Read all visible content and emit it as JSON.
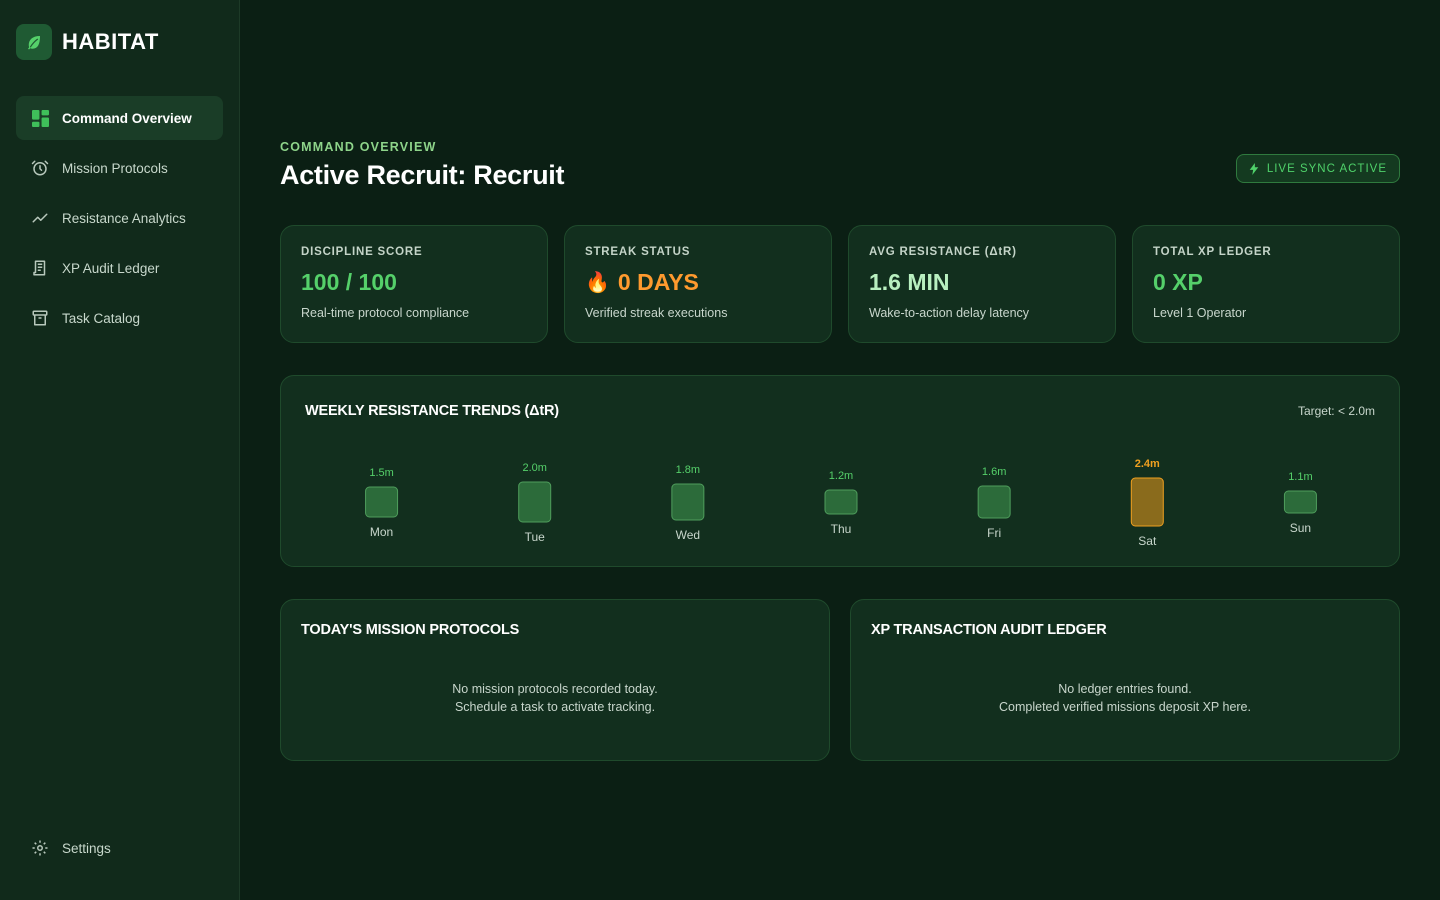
{
  "brand": {
    "name": "HABITAT"
  },
  "sidebar": {
    "items": [
      {
        "label": "Command Overview",
        "icon": "dashboard-icon",
        "active": true
      },
      {
        "label": "Mission Protocols",
        "icon": "alarm-clock-icon",
        "active": false
      },
      {
        "label": "Resistance Analytics",
        "icon": "trend-line-icon",
        "active": false
      },
      {
        "label": "XP Audit Ledger",
        "icon": "receipt-icon",
        "active": false
      },
      {
        "label": "Task Catalog",
        "icon": "archive-box-icon",
        "active": false
      }
    ],
    "settings": {
      "label": "Settings",
      "icon": "gear-icon"
    }
  },
  "header": {
    "eyebrow": "COMMAND OVERVIEW",
    "title": "Active Recruit: Recruit",
    "sync_badge": "LIVE SYNC ACTIVE"
  },
  "stats": [
    {
      "label": "DISCIPLINE SCORE",
      "value": "100 / 100",
      "sub": "Real-time protocol compliance",
      "color": "#55d06a"
    },
    {
      "label": "STREAK STATUS",
      "value": "0 DAYS",
      "sub": "Verified streak executions",
      "color": "#ff9a2e",
      "icon": "fire-icon"
    },
    {
      "label": "AVG RESISTANCE (ΔtR)",
      "value": "1.6 MIN",
      "sub": "Wake-to-action delay latency",
      "color": "#b9f0c0"
    },
    {
      "label": "TOTAL XP LEDGER",
      "value": "0 XP",
      "sub": "Level 1 Operator",
      "color": "#55d06a"
    }
  ],
  "trends": {
    "title": "WEEKLY RESISTANCE TRENDS (ΔtR)",
    "target": "Target: < 2.0m",
    "threshold": 2.0
  },
  "chart_data": {
    "type": "bar",
    "categories": [
      "Mon",
      "Tue",
      "Wed",
      "Thu",
      "Fri",
      "Sat",
      "Sun"
    ],
    "values": [
      1.5,
      2.0,
      1.8,
      1.2,
      1.6,
      2.4,
      1.1
    ],
    "value_labels": [
      "1.5m",
      "2.0m",
      "1.8m",
      "1.2m",
      "1.6m",
      "2.4m",
      "1.1m"
    ],
    "unit": "m",
    "colors": {
      "normal": "#2c6b3a",
      "normal_border": "#4f9e5c",
      "over": "#8a6b1c",
      "over_border": "#f0a020"
    }
  },
  "missions": {
    "title": "TODAY'S MISSION PROTOCOLS",
    "empty_line1": "No mission protocols recorded today.",
    "empty_line2": "Schedule a task to activate tracking."
  },
  "ledger": {
    "title": "XP TRANSACTION AUDIT LEDGER",
    "empty_line1": "No ledger entries found.",
    "empty_line2": "Completed verified missions deposit XP here."
  }
}
